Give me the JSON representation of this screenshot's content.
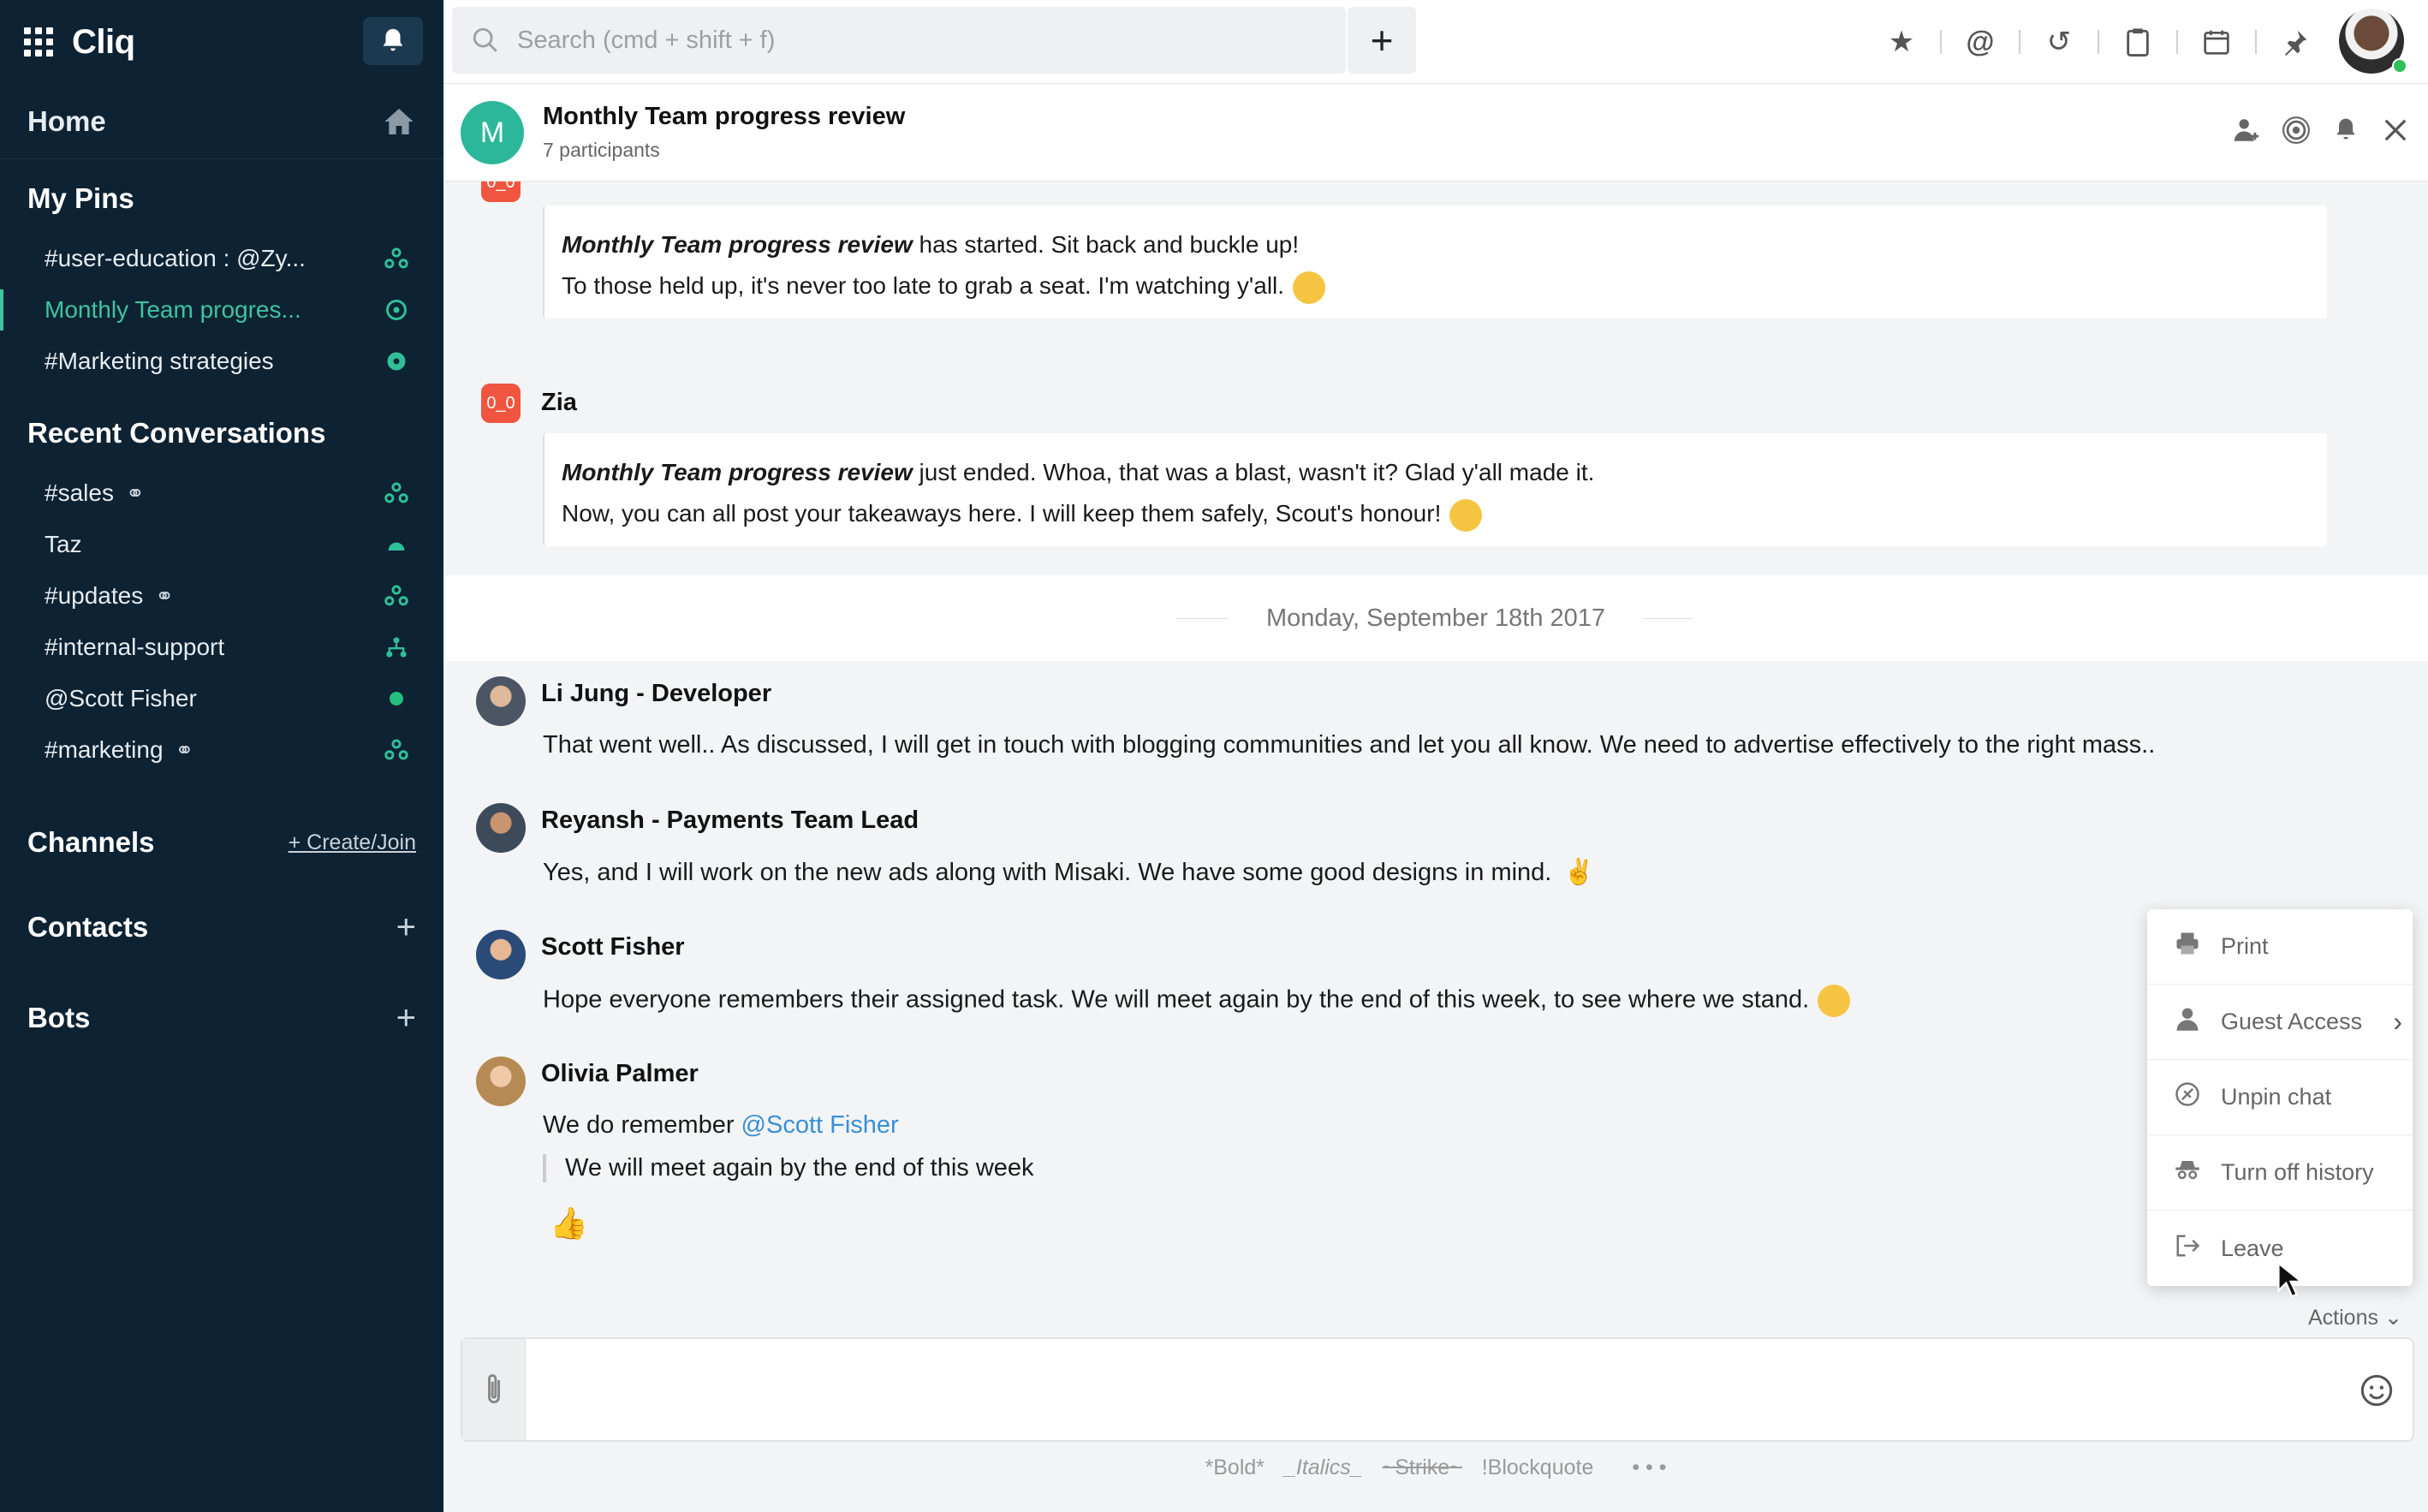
{
  "app": {
    "name": "Cliq"
  },
  "sidebar": {
    "home_label": "Home",
    "pins_heading": "My Pins",
    "pins": [
      {
        "label": "#user-education : @Zy..."
      },
      {
        "label": "Monthly Team progres..."
      },
      {
        "label": "#Marketing strategies"
      }
    ],
    "recent_heading": "Recent Conversations",
    "recent": [
      {
        "label": "#sales"
      },
      {
        "label": "Taz"
      },
      {
        "label": "#updates"
      },
      {
        "label": "#internal-support"
      },
      {
        "label": "@Scott Fisher"
      },
      {
        "label": "#marketing"
      }
    ],
    "channels_heading": "Channels",
    "create_join": "+ Create/Join",
    "contacts_heading": "Contacts",
    "bots_heading": "Bots"
  },
  "topbar": {
    "search_placeholder": "Search (cmd + shift + f)",
    "add_label": "+",
    "icons": [
      "star-icon",
      "at-icon",
      "history-icon",
      "clipboard-icon",
      "calendar-icon",
      "pin-icon"
    ]
  },
  "chat": {
    "avatar_letter": "M",
    "title": "Monthly Team progress review",
    "participants": "7 participants"
  },
  "messages": {
    "bot1": {
      "line1_em": "Monthly Team progress review",
      "line1_rest": " has started. Sit back and buckle up!",
      "line2": "To those held up, it's never too late to grab a seat. I'm watching y'all."
    },
    "bot2": {
      "sender": "Zia",
      "line1_em": "Monthly Team progress review",
      "line1_rest": " just ended. Whoa, that was a blast, wasn't it? Glad y'all made it.",
      "line2": "Now, you can all post your takeaways here. I will keep them safely, Scout's honour!"
    },
    "date_divider": "Monday, September 18th 2017",
    "user_msgs": [
      {
        "sender": "Li Jung - Developer",
        "text": "That went well.. As discussed, I will get in touch with blogging communities and let you all know. We need to advertise effectively to the right mass.."
      },
      {
        "sender": "Reyansh - Payments Team Lead",
        "text": "Yes, and I will work on the new ads along with Misaki. We have some good designs in mind."
      },
      {
        "sender": "Scott Fisher",
        "text": "Hope everyone remembers their assigned task. We will meet again by the end of this week, to see where we stand."
      },
      {
        "sender": "Olivia Palmer",
        "text_before": "We do remember ",
        "mention": "@Scott Fisher",
        "quote": "We will meet again by the end of this week"
      }
    ]
  },
  "actions_menu": {
    "items": [
      {
        "label": "Print"
      },
      {
        "label": "Guest Access"
      },
      {
        "label": "Unpin chat"
      },
      {
        "label": "Turn off history"
      },
      {
        "label": "Leave"
      }
    ],
    "toggle_label": "Actions"
  },
  "composer": {
    "format_hints": [
      "*Bold*",
      "_Italics_",
      "~Strike~",
      "!Blockquote",
      "• • •"
    ]
  },
  "colors": {
    "sidebar_bg": "#0d2233",
    "accent": "#3ec4a0",
    "zia": "#f0553f",
    "mention": "#3a8fd6"
  }
}
